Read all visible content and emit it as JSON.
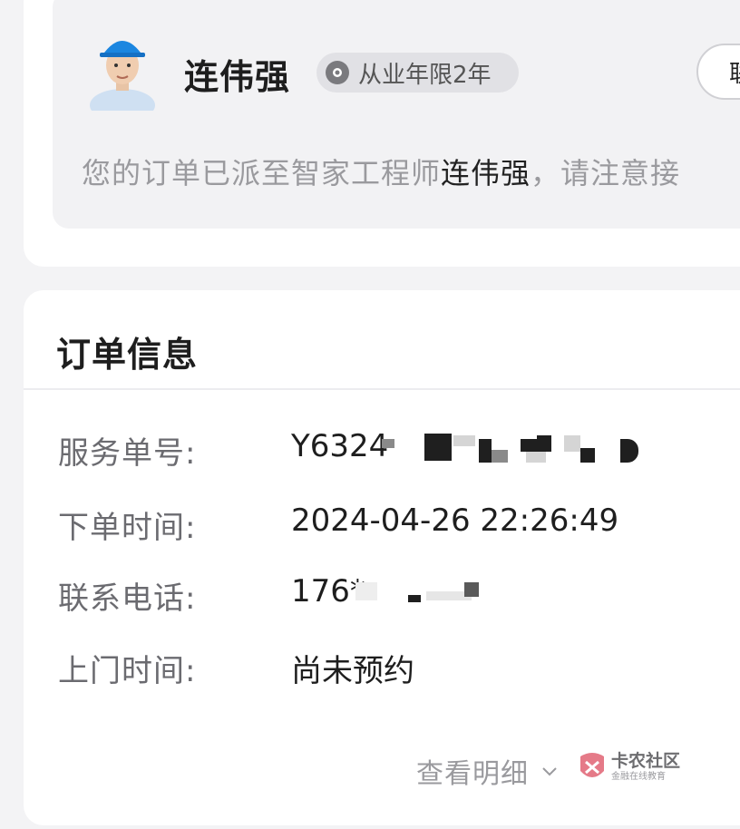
{
  "engineer": {
    "name": "连伟强",
    "experience": "从业年限2年",
    "call_label": "联",
    "dispatch_prefix": "您的订单已派至智家工程师",
    "dispatch_name": "连伟强",
    "dispatch_suffix": "，请注意接"
  },
  "order": {
    "title": "订单信息",
    "rows": [
      {
        "label": "服务单号:",
        "value": "Y6324"
      },
      {
        "label": "下单时间:",
        "value": "2024-04-26 22:26:49"
      },
      {
        "label": "联系电话:",
        "value": "176*"
      },
      {
        "label": "上门时间:",
        "value": "尚未预约"
      }
    ],
    "detail_link": "查看明细"
  },
  "watermark": {
    "main": "卡农社区",
    "sub": "金融在线教育"
  }
}
